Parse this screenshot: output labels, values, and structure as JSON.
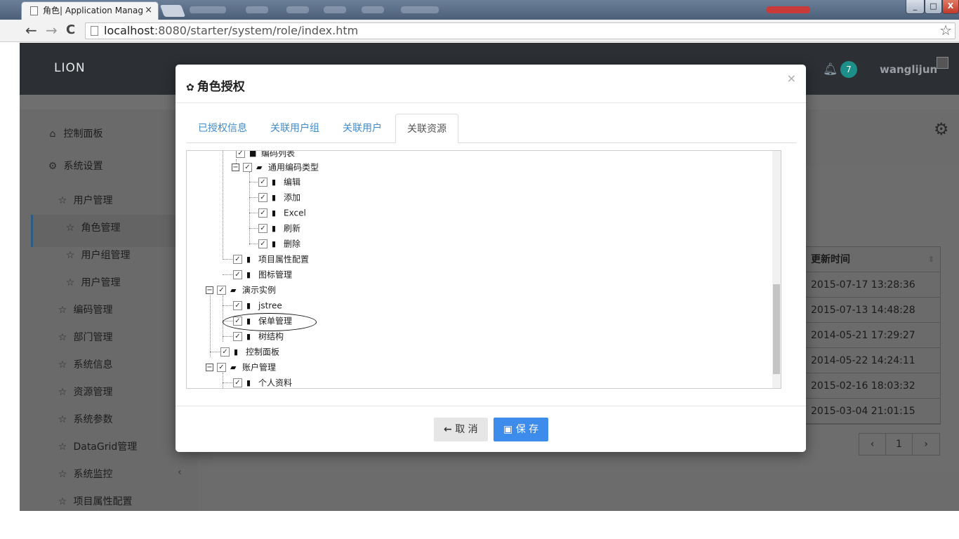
{
  "browser": {
    "tab_title": "角色| Application Manag",
    "tab_close": "×",
    "back": "←",
    "forward": "→",
    "reload": "C",
    "url_host": "localhost",
    "url_path": ":8080/starter/system/role/index.htm",
    "bookmark_star": "☆",
    "win_min": "_",
    "win_max": "□",
    "win_close": "X"
  },
  "app": {
    "brand": "LION",
    "notification_count": "7",
    "username": "wanglijun",
    "bell": "🔔"
  },
  "sidebar": {
    "items": [
      {
        "icon": "⌂",
        "label": "控制面板"
      },
      {
        "icon": "⚙",
        "label": "系统设置"
      },
      {
        "icon": "☆",
        "label": "用户管理"
      },
      {
        "icon": "☆",
        "label": "角色管理"
      },
      {
        "icon": "☆",
        "label": "用户组管理"
      },
      {
        "icon": "☆",
        "label": "用户管理"
      },
      {
        "icon": "☆",
        "label": "编码管理"
      },
      {
        "icon": "☆",
        "label": "部门管理"
      },
      {
        "icon": "☆",
        "label": "系统信息"
      },
      {
        "icon": "☆",
        "label": "资源管理"
      },
      {
        "icon": "☆",
        "label": "系统参数"
      },
      {
        "icon": "☆",
        "label": "DataGrid管理"
      },
      {
        "icon": "☆",
        "label": "系统监控"
      },
      {
        "icon": "☆",
        "label": "项目属性配置"
      }
    ],
    "chevron": "‹"
  },
  "grid": {
    "header": "更新时间",
    "rows": [
      "2015-07-17 13:28:36",
      "2015-07-13 14:48:28",
      "2014-05-21 17:29:27",
      "2014-05-22 14:24:11",
      "2015-02-16 18:03:32",
      "2015-03-04 21:01:15"
    ],
    "pager": {
      "prev": "‹",
      "page": "1",
      "next": "›"
    }
  },
  "modal": {
    "title": "角色授权",
    "close": "×",
    "tabs": [
      "已授权信息",
      "关联用户组",
      "关联用户",
      "关联资源"
    ],
    "tree": [
      {
        "label": "编码列表",
        "type": "file"
      },
      {
        "label": "通用编码类型",
        "type": "folder",
        "toggle": "−"
      },
      {
        "label": "编辑",
        "type": "file"
      },
      {
        "label": "添加",
        "type": "file"
      },
      {
        "label": "Excel",
        "type": "file"
      },
      {
        "label": "刷新",
        "type": "file"
      },
      {
        "label": "删除",
        "type": "file"
      },
      {
        "label": "项目属性配置",
        "type": "file"
      },
      {
        "label": "图标管理",
        "type": "file"
      },
      {
        "label": "演示实例",
        "type": "folder",
        "toggle": "−"
      },
      {
        "label": "jstree",
        "type": "file"
      },
      {
        "label": "保单管理",
        "type": "file"
      },
      {
        "label": "树结构",
        "type": "file"
      },
      {
        "label": "控制面板",
        "type": "file"
      },
      {
        "label": "账户管理",
        "type": "folder",
        "toggle": "−"
      },
      {
        "label": "个人资料",
        "type": "file"
      }
    ],
    "check_mark": "✓",
    "cancel_icon": "🡐",
    "cancel_label": "取 消",
    "save_icon": "🖫",
    "save_label": "保 存"
  }
}
